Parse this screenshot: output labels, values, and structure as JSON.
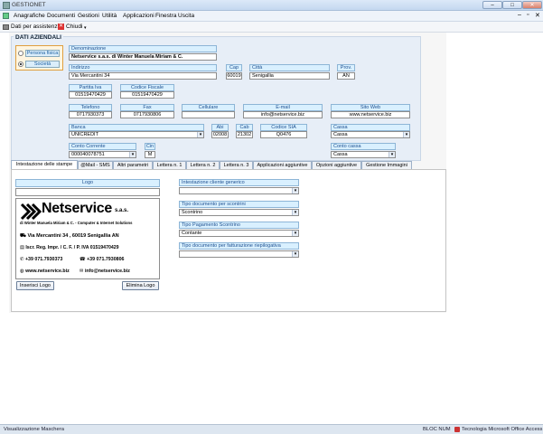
{
  "window": {
    "title": "GESTIONET",
    "minimize": "–",
    "maximize": "□",
    "close": "✕"
  },
  "menu": {
    "items": [
      "Anagrafiche",
      "Documenti",
      "Gestioni",
      "Utilità",
      "Applicazioni",
      "Finestra",
      "Uscita"
    ],
    "right_controls": [
      "–",
      "▫",
      "✕"
    ]
  },
  "toolbar": {
    "assist_label": "Dati per assistenza",
    "close_label": "Chiudi"
  },
  "group": {
    "title": "DATI AZIENDALI"
  },
  "company_type": {
    "options": [
      "Persona fisica",
      "Società"
    ],
    "selected": 1
  },
  "fields": {
    "denominazione": {
      "label": "Denominazione",
      "value": "Netservice s.a.s. di Winter Manuela Miriam & C."
    },
    "indirizzo": {
      "label": "Indirizzo",
      "value": "Via Mercantini 34"
    },
    "cap": {
      "label": "Cap",
      "value": "60019"
    },
    "citta": {
      "label": "Città",
      "value": "Senigallia"
    },
    "prov": {
      "label": "Prov.",
      "value": "AN"
    },
    "piva": {
      "label": "Partita Iva",
      "value": "01519470429"
    },
    "cf": {
      "label": "Codice Fiscale",
      "value": "01519470429"
    },
    "telefono": {
      "label": "Telefono",
      "value": "0717930373"
    },
    "fax": {
      "label": "Fax",
      "value": "0717930806"
    },
    "cellulare": {
      "label": "Cellulare",
      "value": ""
    },
    "email": {
      "label": "E-mail",
      "value": "info@netservice.biz"
    },
    "sito": {
      "label": "Sito Web",
      "value": "www.netservice.biz"
    },
    "banca": {
      "label": "Banca",
      "value": "UNICREDIT"
    },
    "abi": {
      "label": "Abi",
      "value": "02008"
    },
    "cab": {
      "label": "Cab",
      "value": "21302"
    },
    "sia": {
      "label": "Codice SIA",
      "value": "Q0476"
    },
    "cassa": {
      "label": "Cassa",
      "value": "Cassa"
    },
    "conto_corrente": {
      "label": "Conto Corrente",
      "value": "000040078751"
    },
    "cin": {
      "label": "Cin",
      "value": "M"
    },
    "conto_cassa": {
      "label": "Conto cassa",
      "value": "Cassa"
    }
  },
  "tabs": [
    "Intestazione delle stampe",
    "@Mail - SMS",
    "Altri parametri",
    "Lettera n. 1",
    "Lettera n. 2",
    "Lettera n. 3",
    "Applicazioni aggiuntive",
    "Opzioni aggiuntive",
    "Gestione Immagini"
  ],
  "print_header": {
    "logo_label": "Logo",
    "logo": {
      "brand": "Netservice",
      "suffix": "s.a.s.",
      "tagline": "di Winter Manuela Miriam & C. - Computer & Internet Solutions",
      "address": "Via Mercantini 34 , 60019 Senigallia AN",
      "registry": "Iscr. Reg. Impr. / C. F. / P. IVA  01519470429",
      "phone": "+39  071.7930373",
      "fax": "+39  071.7930806",
      "web": "www.netservice.biz",
      "mail": "info@netservice.biz"
    },
    "insert_button": "Inserisci Logo",
    "delete_button": "Elimina Logo",
    "intestazione_generico": {
      "label": "Intestazione cliente generico",
      "value": ""
    },
    "tipo_doc_scontrini": {
      "label": "Tipo documento per scontrini",
      "value": "Scontrino"
    },
    "tipo_pagamento": {
      "label": "Tipo Pagamento Scontrino",
      "value": "Contante"
    },
    "tipo_doc_fatt_riep": {
      "label": "Tipo documento per fatturazione riepilogativa",
      "value": ""
    }
  },
  "status": {
    "left": "Visualizzazione Maschera",
    "num": "BLOC NUM",
    "tech": "Tecnologia Microsoft Office Access"
  },
  "colors": {
    "label_bg": "#d9f0ff",
    "label_text": "#1d4f8f",
    "group_bg": "#e7eef7",
    "radio_border": "#e0a040"
  }
}
